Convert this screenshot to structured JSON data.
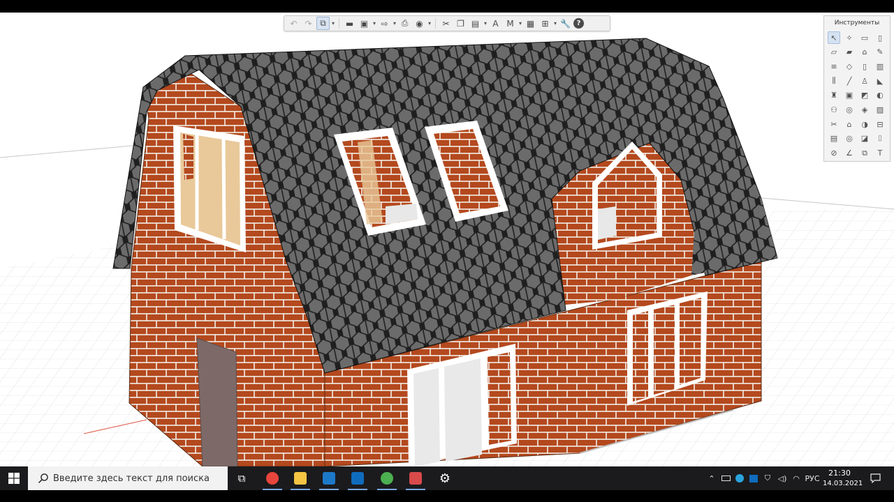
{
  "toolbar": {
    "buttons": [
      {
        "name": "undo-icon",
        "glyph": "↶",
        "dim": true
      },
      {
        "name": "redo-icon",
        "glyph": "↷",
        "dim": true
      },
      {
        "name": "3d-view-icon",
        "glyph": "⧉",
        "active": true,
        "caret": true
      },
      {
        "sep": true
      },
      {
        "name": "open-folder-icon",
        "glyph": "▬"
      },
      {
        "name": "save-icon",
        "glyph": "▣",
        "caret": true
      },
      {
        "name": "export-icon",
        "glyph": "⇨",
        "caret": true
      },
      {
        "name": "print-icon",
        "glyph": "⎙"
      },
      {
        "name": "navigation-icon",
        "glyph": "◉",
        "caret": true
      },
      {
        "sep": true
      },
      {
        "name": "cut-icon",
        "glyph": "✂"
      },
      {
        "name": "copy-icon",
        "glyph": "❐"
      },
      {
        "name": "paste-icon",
        "glyph": "▤",
        "caret": true
      },
      {
        "name": "text-style-icon",
        "glyph": "A"
      },
      {
        "name": "materials-icon",
        "glyph": "M",
        "caret": true
      },
      {
        "name": "layers-icon",
        "glyph": "▦"
      },
      {
        "name": "view-settings-icon",
        "glyph": "⊞",
        "caret": true
      },
      {
        "name": "wrench-icon",
        "glyph": "🔧"
      },
      {
        "name": "help-icon",
        "glyph": "?",
        "help": true
      }
    ]
  },
  "tools_palette": {
    "title": "Инструменты",
    "items": [
      {
        "name": "arrow-select-icon",
        "glyph": "↖",
        "active": true
      },
      {
        "name": "magic-wand-icon",
        "glyph": "✧"
      },
      {
        "name": "rectangle-icon",
        "glyph": "▭"
      },
      {
        "name": "column-icon",
        "glyph": "▯"
      },
      {
        "name": "slab-icon",
        "glyph": "▱"
      },
      {
        "name": "beam-icon",
        "glyph": "▰"
      },
      {
        "name": "roof-icon",
        "glyph": "⌂"
      },
      {
        "name": "pencil-icon",
        "glyph": "✎"
      },
      {
        "name": "stair-icon",
        "glyph": "≡"
      },
      {
        "name": "mesh-icon",
        "glyph": "◇"
      },
      {
        "name": "door-icon",
        "glyph": "▯"
      },
      {
        "name": "window-icon",
        "glyph": "▥"
      },
      {
        "name": "railing-icon",
        "glyph": "⫼"
      },
      {
        "name": "line-icon",
        "glyph": "╱"
      },
      {
        "name": "lamp-icon",
        "glyph": "♙"
      },
      {
        "name": "curtain-wall-icon",
        "glyph": "◣"
      },
      {
        "name": "object-icon",
        "glyph": "♜"
      },
      {
        "name": "cabinet-icon",
        "glyph": "▣"
      },
      {
        "name": "label-icon",
        "glyph": "◩"
      },
      {
        "name": "shell-icon",
        "glyph": "◐"
      },
      {
        "name": "zone-icon",
        "glyph": "⚇"
      },
      {
        "name": "camera-icon",
        "glyph": "◎"
      },
      {
        "name": "morph-icon",
        "glyph": "◈"
      },
      {
        "name": "fill-icon",
        "glyph": "▨"
      },
      {
        "name": "wall-end-icon",
        "glyph": "✂"
      },
      {
        "name": "skylight-icon",
        "glyph": "⌂"
      },
      {
        "name": "section-icon",
        "glyph": "◑"
      },
      {
        "name": "elevation-icon",
        "glyph": "⊟"
      },
      {
        "name": "worksheet-icon",
        "glyph": "▤"
      },
      {
        "name": "detail-icon",
        "glyph": "◎"
      },
      {
        "name": "dimension-icon",
        "glyph": "◪"
      },
      {
        "name": "marker-icon",
        "glyph": "⌷"
      },
      {
        "name": "radial-dimension-icon",
        "glyph": "⊘"
      },
      {
        "name": "angle-dimension-icon",
        "glyph": "∠"
      },
      {
        "name": "level-dimension-icon",
        "glyph": "⧉"
      },
      {
        "name": "text-tool-icon",
        "glyph": "T"
      }
    ]
  },
  "taskbar": {
    "search_placeholder": "Введите здесь текст для поиска",
    "apps": [
      {
        "name": "task-view-icon",
        "glyph": "⧉",
        "color": "#ffffff",
        "running": false
      },
      {
        "name": "chrome-icon",
        "color": "#e8453c",
        "running": true
      },
      {
        "name": "file-explorer-icon",
        "color": "#f4c542",
        "running": true
      },
      {
        "name": "editor-app-icon",
        "color": "#1e78c8",
        "running": true
      },
      {
        "name": "outlook-icon",
        "color": "#0f6cbd",
        "running": true
      },
      {
        "name": "chrome-profile-icon",
        "color": "#4caf50",
        "running": true
      },
      {
        "name": "archicad-icon",
        "color": "#d94a4a",
        "running": true
      },
      {
        "name": "settings-gear-icon",
        "color": "#ffffff",
        "running": false
      }
    ],
    "tray": {
      "language": "РУС",
      "time": "21:30",
      "date": "14.03.2021"
    }
  },
  "colors": {
    "brick": "#b4491e",
    "mortar": "#f2efe9",
    "roof_tile": "#6b6b6b",
    "roof_outline": "#1f1f1f",
    "frame": "#ffffff",
    "door": "#7d6a68",
    "glass": "#e9c99a",
    "grid_line": "#d8d8d8"
  }
}
